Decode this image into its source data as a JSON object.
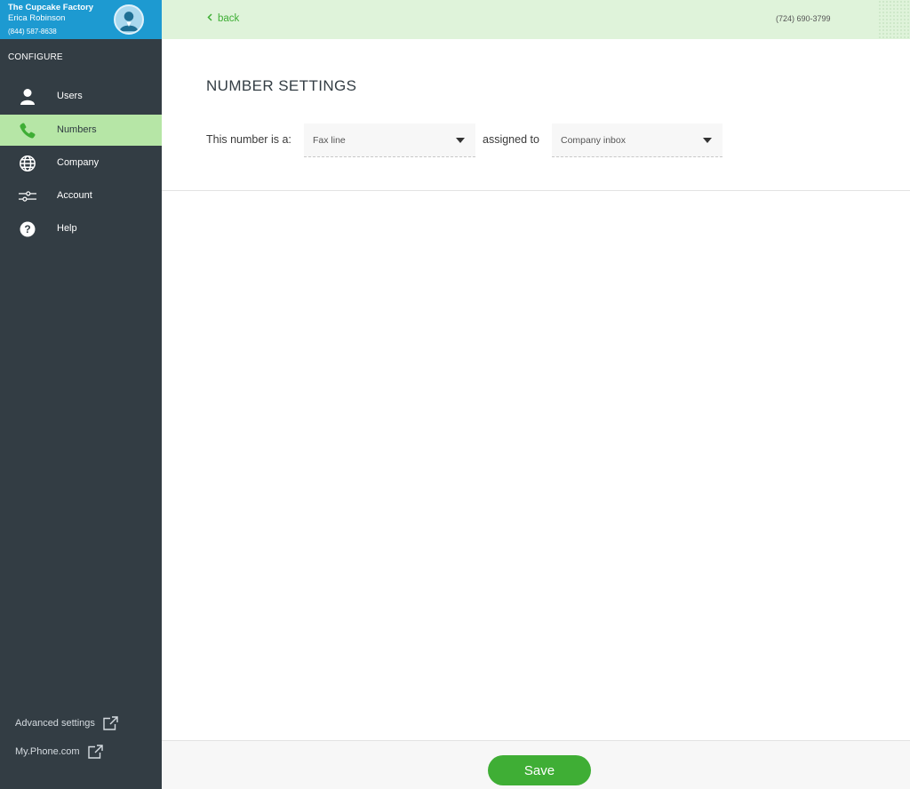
{
  "account": {
    "company": "The Cupcake Factory",
    "user": "Erica Robinson",
    "phone": "(844) 587-8638",
    "avatar_icon": "user-avatar-icon"
  },
  "sidebar": {
    "section_label": "CONFIGURE",
    "items": [
      {
        "label": "Users",
        "icon": "user-icon",
        "active": false
      },
      {
        "label": "Numbers",
        "icon": "phone-icon",
        "active": true
      },
      {
        "label": "Company",
        "icon": "globe-icon",
        "active": false
      },
      {
        "label": "Account",
        "icon": "sliders-icon",
        "active": false
      },
      {
        "label": "Help",
        "icon": "help-icon",
        "active": false
      }
    ],
    "links": [
      {
        "label": "Advanced settings",
        "icon": "external-link-icon"
      },
      {
        "label": "My.Phone.com",
        "icon": "external-link-icon"
      }
    ]
  },
  "topbar": {
    "back_label": "back",
    "phone_number": "(724) 690-3799"
  },
  "main": {
    "title": "NUMBER SETTINGS",
    "type_label": "This number is a:",
    "type_value": "Fax line",
    "assigned_label": "assigned to",
    "assigned_value": "Company inbox"
  },
  "footer": {
    "save_label": "Save"
  },
  "colors": {
    "accent_green": "#3fae35",
    "sidebar_bg": "#333d44",
    "active_item_bg": "#b6e6a6",
    "account_header_bg": "#1d9ad1",
    "topbar_bg": "#dff3da"
  }
}
